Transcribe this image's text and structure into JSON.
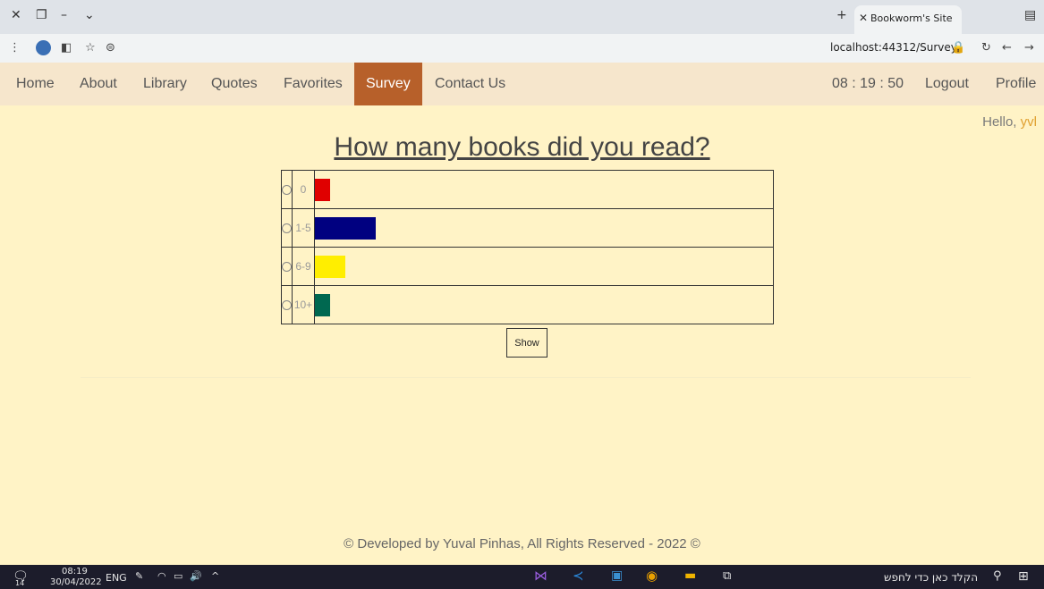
{
  "browser": {
    "tab_title": "Bookworm's Site",
    "url": "localhost:44312/Survey"
  },
  "nav": {
    "left": [
      "Home",
      "About",
      "Library",
      "Quotes",
      "Favorites",
      "Survey",
      "Contact Us"
    ],
    "active": "Survey",
    "clock": "08 : 19 : 50",
    "logout": "Logout",
    "profile": "Profile",
    "greeting": "Hello, ",
    "username": "yvl"
  },
  "survey": {
    "question": "How many books did you read?",
    "options": [
      {
        "label": "0",
        "color": "#e00000"
      },
      {
        "label": "1-5",
        "color": "#000080"
      },
      {
        "label": "6-9",
        "color": "#ffee00"
      },
      {
        "label": "10+",
        "color": "#006850"
      }
    ],
    "show_label": "Show"
  },
  "chart_data": {
    "type": "bar",
    "categories": [
      "0",
      "1-5",
      "6-9",
      "10+"
    ],
    "values": [
      1,
      4,
      2,
      1
    ],
    "colors": [
      "#e00000",
      "#000080",
      "#ffee00",
      "#006850"
    ]
  },
  "footer": "© Developed by Yuval Pinhas, All Rights Reserved - 2022 ©",
  "taskbar": {
    "time": "08:19",
    "date": "30/04/2022",
    "lang": "ENG",
    "search_placeholder": "הקלד כאן כדי לחפש",
    "notification_count": "14"
  }
}
